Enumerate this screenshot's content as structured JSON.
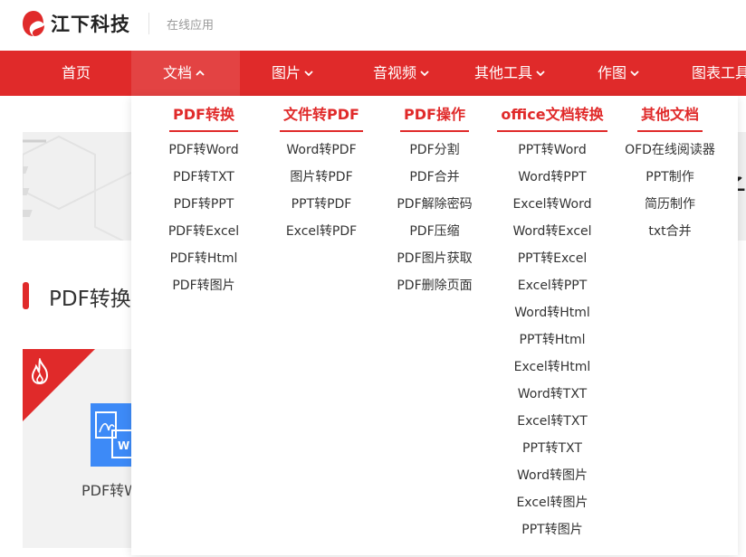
{
  "header": {
    "brand": "江下科技",
    "subtitle": "在线应用",
    "logo_color": "#e02a2a"
  },
  "nav": {
    "items": [
      {
        "label": "首页",
        "has_chevron": false,
        "active": false
      },
      {
        "label": "文档",
        "has_chevron": true,
        "chevron": "up",
        "active": true
      },
      {
        "label": "图片",
        "has_chevron": true,
        "chevron": "down",
        "active": false
      },
      {
        "label": "音视频",
        "has_chevron": true,
        "chevron": "down",
        "active": false
      },
      {
        "label": "其他工具",
        "has_chevron": true,
        "chevron": "down",
        "active": false
      },
      {
        "label": "作图",
        "has_chevron": true,
        "chevron": "down",
        "active": false
      },
      {
        "label": "图表工具",
        "has_chevron": false,
        "active": false
      }
    ],
    "background": "#e02a2a"
  },
  "dropdown": {
    "columns": [
      {
        "title": "PDF转换",
        "items": [
          "PDF转Word",
          "PDF转TXT",
          "PDF转PPT",
          "PDF转Excel",
          "PDF转Html",
          "PDF转图片"
        ]
      },
      {
        "title": "文件转PDF",
        "items": [
          "Word转PDF",
          "图片转PDF",
          "PPT转PDF",
          "Excel转PDF"
        ]
      },
      {
        "title": "PDF操作",
        "items": [
          "PDF分割",
          "PDF合并",
          "PDF解除密码",
          "PDF压缩",
          "PDF图片获取",
          "PDF删除页面"
        ]
      },
      {
        "title": "office文档转换",
        "items": [
          "PPT转Word",
          "Word转PPT",
          "Excel转Word",
          "Word转Excel",
          "PPT转Excel",
          "Excel转PPT",
          "Word转Html",
          "PPT转Html",
          "Excel转Html",
          "Word转TXT",
          "Excel转TXT",
          "PPT转TXT",
          "Word转图片",
          "Excel转图片",
          "PPT转图片"
        ]
      },
      {
        "title": "其他文档",
        "items": [
          "OFD在线阅读器",
          "PPT制作",
          "简历制作",
          "txt合并"
        ]
      }
    ]
  },
  "content": {
    "banner_char": "子",
    "section_title": "PDF转换",
    "card_label": "PDF转Word",
    "hot_icon": "flame-icon",
    "card_icon": "pdf-to-word-icon",
    "accent": "#e02a2a",
    "card_icon_color": "#3d8af7"
  }
}
